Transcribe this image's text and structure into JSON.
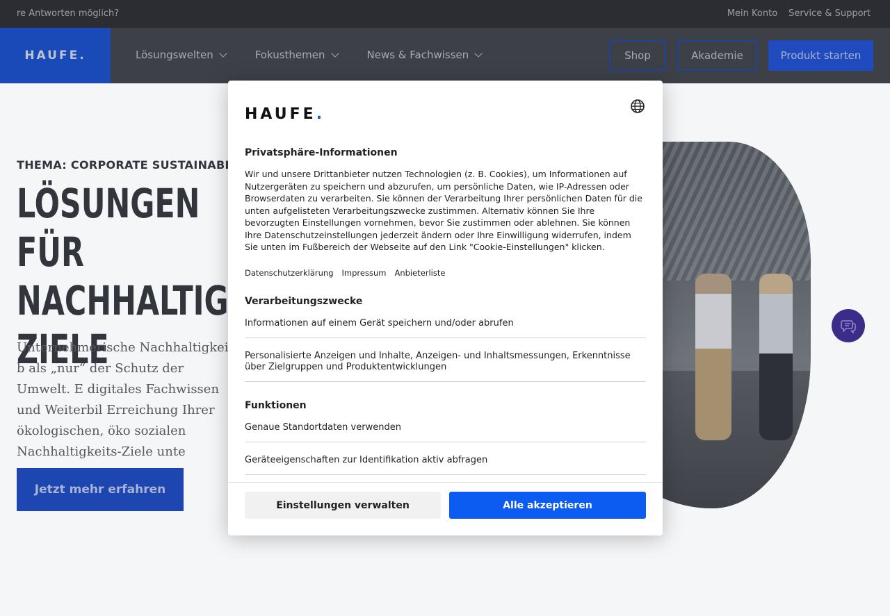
{
  "topbar": {
    "left_text": "re Antworten möglich?",
    "links": [
      "Mein Konto",
      "Service & Support"
    ]
  },
  "navbar": {
    "logo": "HAUFE.",
    "items": [
      "Lösungswelten",
      "Fokusthemen",
      "News & Fachwissen"
    ],
    "shop": "Shop",
    "akademie": "Akademie",
    "produkt_starten": "Produkt starten"
  },
  "hero": {
    "overline": "THEMA: CORPORATE SUSTAINABILITY",
    "title": "Lösungen für\nNachhaltigke\nZiele",
    "body": "Unternehmerische Nachhaltigkeit b als „nur“ der Schutz der Umwelt. E digitales Fachwissen und Weiterbil Erreichung Ihrer ökologischen, öko sozialen Nachhaltigkeits-Ziele unte",
    "cta": "Jetzt mehr erfahren"
  },
  "chat_icon": "chat-icon",
  "consent": {
    "logo": "HAUFE",
    "logo_dot": ".",
    "language_icon": "globe-icon",
    "heading": "Privatsphäre-Informationen",
    "text": "Wir und unsere Drittanbieter nutzen Technologien (z. B. Cookies), um Informationen auf Nutzergeräten zu speichern und abzurufen, um persönliche Daten, wie IP-Adressen oder Browserdaten zu verarbeiten. Sie können der Verarbeitung Ihrer persönlichen Daten für die unten aufgelisteten Verarbeitungszwecke zustimmen. Alternativ können Sie Ihre bevorzugten Einstellungen vornehmen, bevor Sie zustimmen oder ablehnen. Sie können Ihre Datenschutzeinstellungen jederzeit ändern oder Ihre Einwilligung widerrufen, indem Sie unten im Fußbereich der Webseite auf den Link \"Cookie-Einstellungen\" klicken.",
    "links": [
      "Datenschutzerklärung",
      "Impressum",
      "Anbieterliste"
    ],
    "purposes_heading": "Verarbeitungszwecke",
    "purposes": [
      "Informationen auf einem Gerät speichern und/oder abrufen",
      "Personalisierte Anzeigen und Inhalte, Anzeigen- und Inhaltsmessungen, Erkenntnisse über Zielgruppen und Produktentwicklungen"
    ],
    "functions_heading": "Funktionen",
    "functions": [
      "Genaue Standortdaten verwenden",
      "Geräteeigenschaften zur Identifikation aktiv abfragen"
    ],
    "manage_button": "Einstellungen verwalten",
    "accept_button": "Alle akzeptieren"
  }
}
